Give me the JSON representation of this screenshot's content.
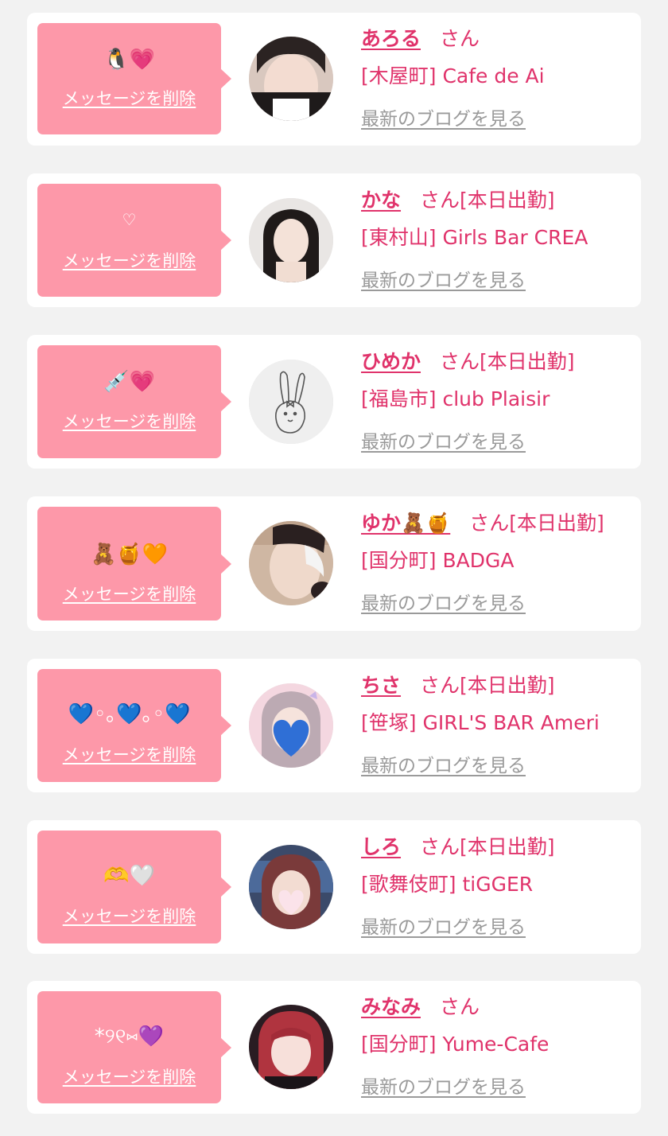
{
  "labels": {
    "delete": "メッセージを削除",
    "latest_blog": "最新のブログを見る",
    "honorific": "さん"
  },
  "entries": [
    {
      "message": "🐧💗",
      "name": "あろる",
      "status": "",
      "shop": "[木屋町] Cafe de Ai"
    },
    {
      "message": "♡",
      "name": "かな",
      "status": "[本日出勤]",
      "shop": "[東村山] Girls Bar CREA"
    },
    {
      "message": "💉💗",
      "name": "ひめか",
      "status": "[本日出勤]",
      "shop": "[福島市] club Plaisir"
    },
    {
      "message": "🧸🍯🧡",
      "name": "ゆか🧸🍯",
      "status": "[本日出勤]",
      "shop": "[国分町] BADGA"
    },
    {
      "message": "💙◦｡💙｡◦💙",
      "name": "ちさ",
      "status": "[本日出勤]",
      "shop": "[笹塚] GIRL'S BAR Ameri"
    },
    {
      "message": "🫶🤍",
      "name": "しろ",
      "status": "[本日出勤]",
      "shop": "[歌舞伎町] tiGGER"
    },
    {
      "message": "*୨୧⑅💜",
      "name": "みなみ",
      "status": "",
      "shop": "[国分町] Yume-Cafe"
    }
  ],
  "colors": {
    "page_bg": "#f2f2f2",
    "card_bg": "#ffffff",
    "bubble_bg": "#fd98a9",
    "accent_pink": "#e0336b",
    "blog_link_gray": "#9a9a9a"
  }
}
